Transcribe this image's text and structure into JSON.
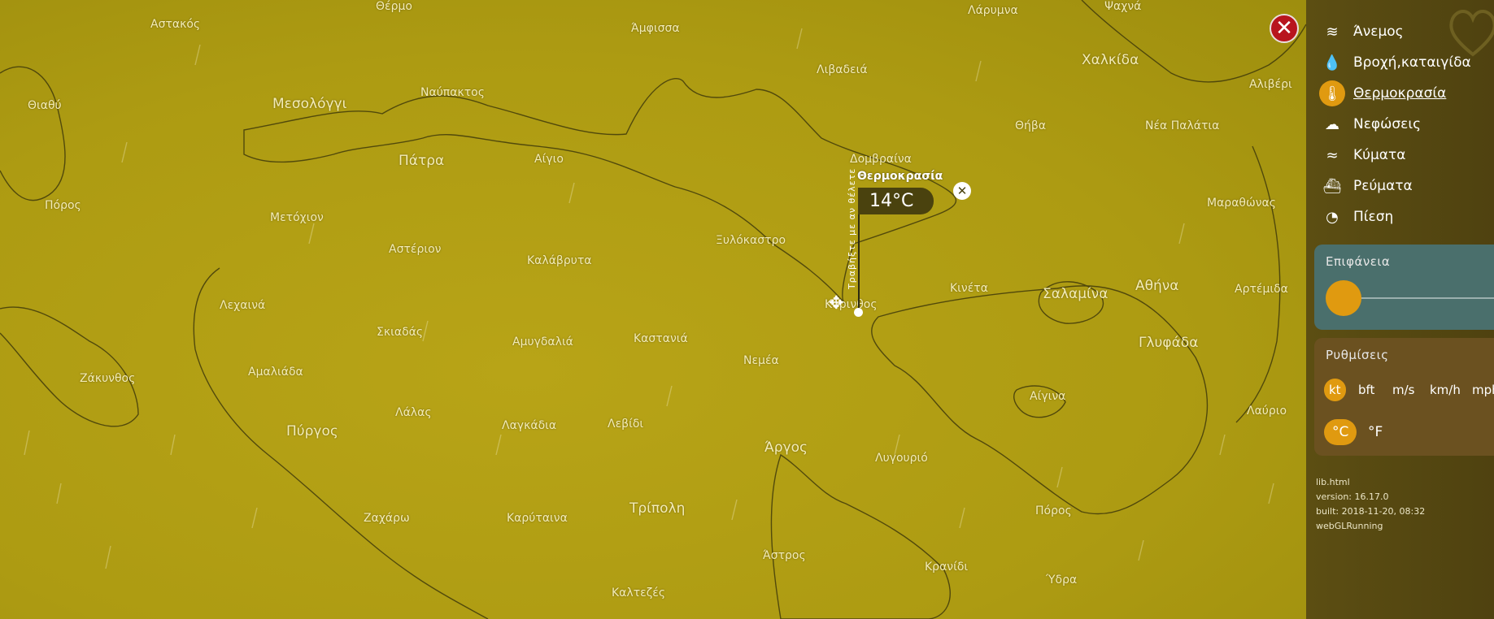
{
  "map": {
    "places": [
      {
        "name": "Θέρμο",
        "big": false
      },
      {
        "name": "Αστακός",
        "big": false
      },
      {
        "name": "Άμφισσα",
        "big": false
      },
      {
        "name": "Λάρυμνα",
        "big": false
      },
      {
        "name": "Ψαχνά",
        "big": false
      },
      {
        "name": "Θιαθύ",
        "big": false
      },
      {
        "name": "Μεσολόγγι",
        "big": true
      },
      {
        "name": "Ναύπακτος",
        "big": false
      },
      {
        "name": "Λιβαδειά",
        "big": false
      },
      {
        "name": "Χαλκίδα",
        "big": true
      },
      {
        "name": "Αλιβέρι",
        "big": false
      },
      {
        "name": "Θήβα",
        "big": false
      },
      {
        "name": "Νέα Παλάτια",
        "big": false
      },
      {
        "name": "Πάτρα",
        "big": true
      },
      {
        "name": "Αίγιο",
        "big": false
      },
      {
        "name": "Δομβραίνα",
        "big": false
      },
      {
        "name": "Πόρος",
        "big": false
      },
      {
        "name": "Μετόχιον",
        "big": false
      },
      {
        "name": "Μαραθώνας",
        "big": false
      },
      {
        "name": "Αστέριον",
        "big": false
      },
      {
        "name": "Καλάβρυτα",
        "big": false
      },
      {
        "name": "Ξυλόκαστρο",
        "big": false
      },
      {
        "name": "Λεχαινά",
        "big": false
      },
      {
        "name": "Κόρινθος",
        "big": false
      },
      {
        "name": "Κινέτα",
        "big": false
      },
      {
        "name": "Σαλαμίνα",
        "big": true
      },
      {
        "name": "Αθήνα",
        "big": true
      },
      {
        "name": "Αρτέμιδα",
        "big": false
      },
      {
        "name": "Σκιαδάς",
        "big": false
      },
      {
        "name": "Αμυγδαλιά",
        "big": false
      },
      {
        "name": "Καστανιά",
        "big": false
      },
      {
        "name": "Γλυφάδα",
        "big": true
      },
      {
        "name": "Αμαλιάδα",
        "big": false
      },
      {
        "name": "Νεμέα",
        "big": false
      },
      {
        "name": "Ζάκυνθος",
        "big": false
      },
      {
        "name": "Λάλας",
        "big": false
      },
      {
        "name": "Αίγινα",
        "big": false
      },
      {
        "name": "Λαύριο",
        "big": false
      },
      {
        "name": "Λαγκάδια",
        "big": false
      },
      {
        "name": "Λεβίδι",
        "big": false
      },
      {
        "name": "Πύργος",
        "big": true
      },
      {
        "name": "Άργος",
        "big": true
      },
      {
        "name": "Λυγουριό",
        "big": false
      },
      {
        "name": "Ζαχάρω",
        "big": false
      },
      {
        "name": "Καρύταινα",
        "big": false
      },
      {
        "name": "Τρίπολη",
        "big": true
      },
      {
        "name": "Πόρος",
        "big": false
      },
      {
        "name": "Άστρος",
        "big": false
      },
      {
        "name": "Κρανίδι",
        "big": false
      },
      {
        "name": "Ύδρα",
        "big": false
      },
      {
        "name": "Καλτεζές",
        "big": false
      }
    ],
    "picker": {
      "label": "Θερμοκρασία",
      "value": "14°C",
      "close_glyph": "✕",
      "drag_hint": "Τραβήξτε με αν θέλετε",
      "drag_glyph": "✥"
    },
    "close_glyph": "✕"
  },
  "panel": {
    "layers": [
      {
        "label": "Άνεμος",
        "icon": "wind-icon",
        "glyph": "≋",
        "active": false
      },
      {
        "label": "Βροχή,καταιγίδα",
        "icon": "rain-drop-icon",
        "glyph": "💧",
        "active": false
      },
      {
        "label": "Θερμοκρασία",
        "icon": "thermometer-icon",
        "glyph": "🌡",
        "active": true
      },
      {
        "label": "Νεφώσεις",
        "icon": "cloud-icon",
        "glyph": "☁",
        "active": false
      },
      {
        "label": "Κύματα",
        "icon": "waves-icon",
        "glyph": "≈",
        "active": false
      },
      {
        "label": "Ρεύματα",
        "icon": "ship-icon",
        "glyph": "⛴",
        "active": false
      },
      {
        "label": "Πίεση",
        "icon": "gauge-icon",
        "glyph": "◔",
        "active": false
      }
    ],
    "surface": {
      "title": "Επιφάνεια"
    },
    "settings": {
      "title": "Ρυθμίσεις",
      "wind_units": [
        {
          "label": "kt",
          "selected": true
        },
        {
          "label": "bft",
          "selected": false
        },
        {
          "label": "m/s",
          "selected": false
        },
        {
          "label": "km/h",
          "selected": false
        },
        {
          "label": "mph",
          "selected": false
        }
      ],
      "temp_units": [
        {
          "label": "°C",
          "selected": true
        },
        {
          "label": "°F",
          "selected": false
        }
      ]
    },
    "version": {
      "line1": "lib.html",
      "line2": "version: 16.17.0",
      "line3": "built: 2018-11-20, 08:32",
      "line4": "webGLRunning"
    }
  },
  "colors": {
    "map_fill": "#ad9b12",
    "accent": "#e09a10",
    "panel_bg": "#5c4e12",
    "close_red": "#b8141d"
  }
}
